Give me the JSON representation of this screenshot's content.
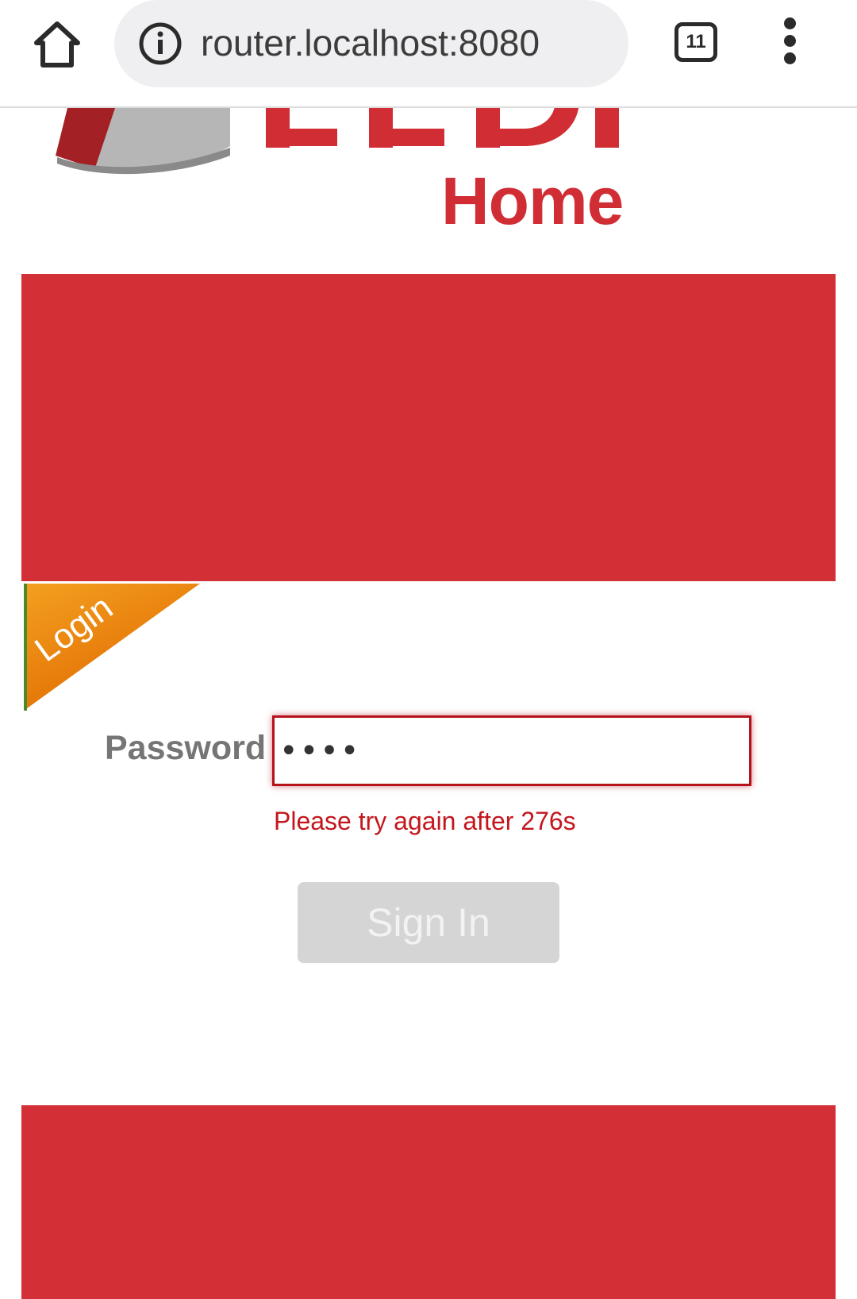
{
  "browser": {
    "url": "router.localhost:8080",
    "tab_count": "11"
  },
  "brand": {
    "home_label": "Home",
    "primary_color": "#d32f36"
  },
  "login": {
    "ribbon_label": "Login",
    "password_label": "Password",
    "password_value": "••••",
    "error_message": "Please try again after 276s",
    "signin_label": "Sign In"
  }
}
